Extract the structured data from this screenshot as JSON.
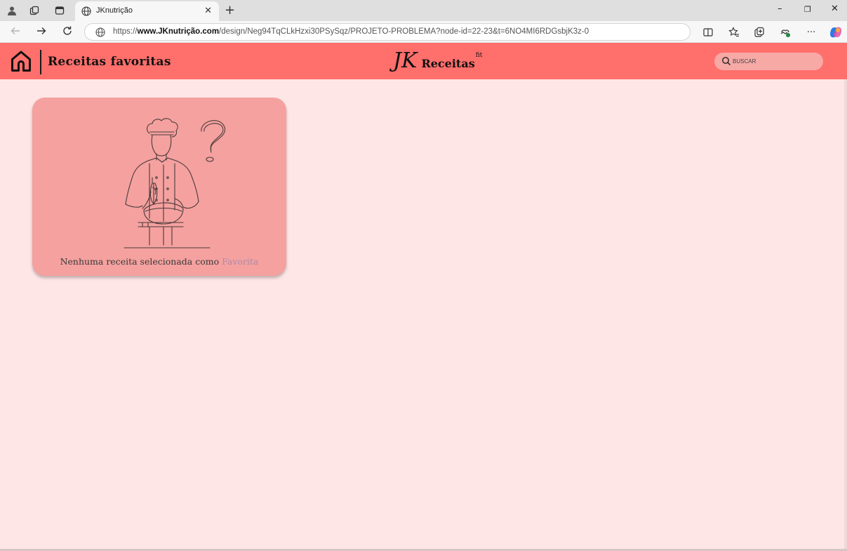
{
  "browser": {
    "tab_title": "JKnutrição",
    "tab_close": "✕",
    "new_tab": "+",
    "url_prefix": "https://",
    "url_host": "www.JKnutrição.com",
    "url_path": "/design/Neg94TqCLkHzxi30PSySqz/PROJETO-PROBLEMA?node-id=22-23&t=6NO4MI6RDGsbjK3z-0",
    "more_label": "···",
    "window_controls": {
      "minimize": "–",
      "restore": "❐",
      "close": "✕"
    }
  },
  "header": {
    "title": "Receitas favoritas",
    "brand_logo": "JK",
    "brand_name": "Receitas",
    "brand_sup": "fit",
    "search_placeholder": "BUSCAR",
    "colors": {
      "bar": "#ff6f6b",
      "search": "#f7a9a6"
    }
  },
  "main": {
    "empty_card": {
      "message_prefix": "Nenhuma receita selecionada como ",
      "message_accent": "Favorita",
      "illustration": "chef-with-question-mark-icon",
      "colors": {
        "card": "#f4a19f",
        "accent": "#b08aa8"
      }
    },
    "background": "#ffe6e6"
  }
}
